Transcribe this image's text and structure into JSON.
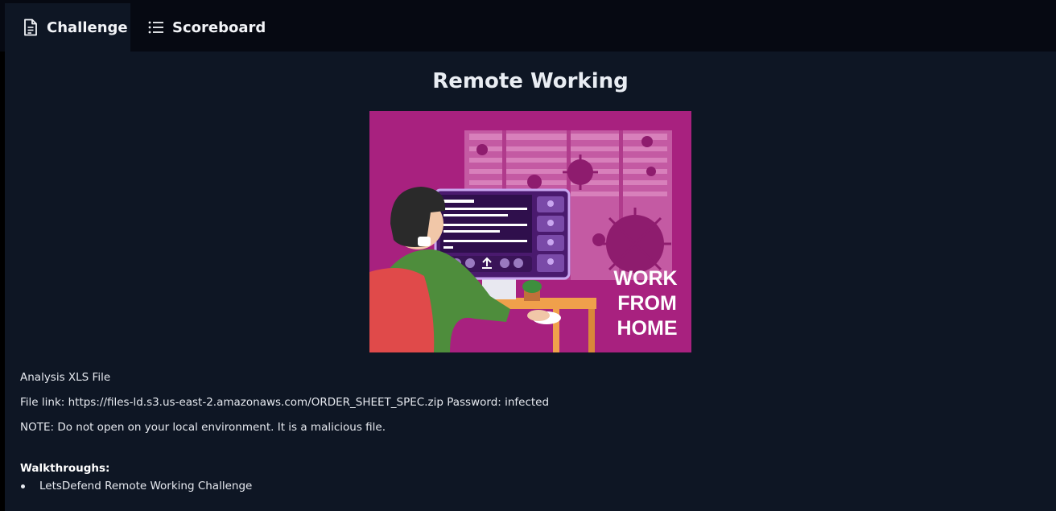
{
  "tabs": [
    {
      "label": "Challenge",
      "icon": "document-icon",
      "active": true
    },
    {
      "label": "Scoreboard",
      "icon": "list-icon",
      "active": false
    }
  ],
  "challenge": {
    "title": "Remote Working",
    "image": {
      "icon": "work-from-home-illustration",
      "caption_lines": [
        "WORK",
        "FROM",
        "HOME"
      ]
    },
    "description": [
      "Analysis XLS File",
      "File link: https://files-ld.s3.us-east-2.amazonaws.com/ORDER_SHEET_SPEC.zip Password: infected",
      "NOTE: Do not open on your local environment. It is a malicious file."
    ],
    "walkthroughs_label": "Walkthroughs:",
    "walkthroughs": [
      "LetsDefend Remote Working Challenge"
    ]
  },
  "colors": {
    "page_bg": "#0e1624",
    "tabbar_bg": "#060912",
    "illustration_bg": "#a8217f"
  }
}
